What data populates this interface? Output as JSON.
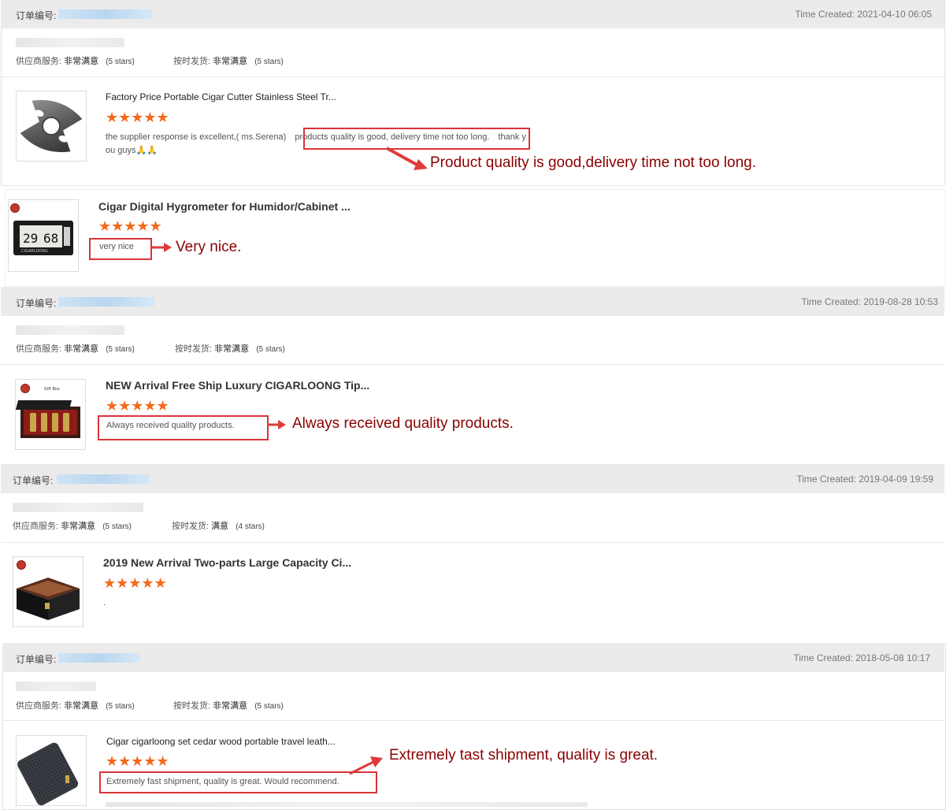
{
  "orders": [
    {
      "order_label": "订单编号:",
      "time_created": "Time Created: 2021-04-10 06:05",
      "ratings": [
        {
          "label": "供应商服务:",
          "value": "非常满意",
          "stars": "(5 stars)"
        },
        {
          "label": "按时发货:",
          "value": "非常满意",
          "stars": "(5 stars)"
        }
      ]
    },
    {
      "order_label": "订单编号:",
      "time_created": "Time Created: 2019-08-28 10:53",
      "ratings": [
        {
          "label": "供应商服务:",
          "value": "非常满意",
          "stars": "(5 stars)"
        },
        {
          "label": "按时发货:",
          "value": "非常满意",
          "stars": "(5 stars)"
        }
      ]
    },
    {
      "order_label": "订单编号:",
      "time_created": "Time Created: 2019-04-09 19:59",
      "ratings": [
        {
          "label": "供应商服务:",
          "value": "非常满意",
          "stars": "(5 stars)"
        },
        {
          "label": "按时发货:",
          "value": "满意",
          "stars": "(4 stars)"
        }
      ]
    },
    {
      "order_label": "订单编号:",
      "time_created": "Time Created: 2018-05-08 10:17",
      "ratings": [
        {
          "label": "供应商服务:",
          "value": "非常满意",
          "stars": "(5 stars)"
        },
        {
          "label": "按时发货:",
          "value": "非常满意",
          "stars": "(5 stars)"
        }
      ]
    }
  ],
  "products": [
    {
      "title": "Factory Price Portable Cigar Cutter Stainless Steel Tr...",
      "stars": "★★★★★",
      "review_before": "the supplier response is excellent,( ms.Serena)",
      "review_highlight": "products quality is good, delivery time not too long.",
      "review_after": "thank y",
      "review_line2": "ou guys🙏🙏",
      "annotation": "Product quality is good,delivery time not too long."
    },
    {
      "title": "Cigar Digital Hygrometer for Humidor/Cabinet ...",
      "stars": "★★★★★",
      "review_highlight": "very nice",
      "annotation": "Very nice.",
      "thumb_text": "CIGARLOONG"
    },
    {
      "title": "NEW Arrival Free Ship Luxury CIGARLOONG Tip...",
      "stars": "★★★★★",
      "review_highlight": "Always received quality products.",
      "annotation": "Always received quality products.",
      "thumb_text": "Gift Box"
    },
    {
      "title": "2019 New Arrival Two-parts Large Capacity Ci...",
      "stars": "★★★★★",
      "review_text": "."
    },
    {
      "title": "Cigar cigarloong set cedar wood portable travel leath...",
      "stars": "★★★★★",
      "review_highlight": "Extremely fast shipment, quality is great. Would recommend.",
      "annotation": "Extremely tast shipment, quality is great."
    }
  ],
  "colors": {
    "star": "#f26a1b",
    "highlight_box": "#d9343b",
    "annotation_text": "#8b0000",
    "header_bg": "#ebebeb"
  }
}
